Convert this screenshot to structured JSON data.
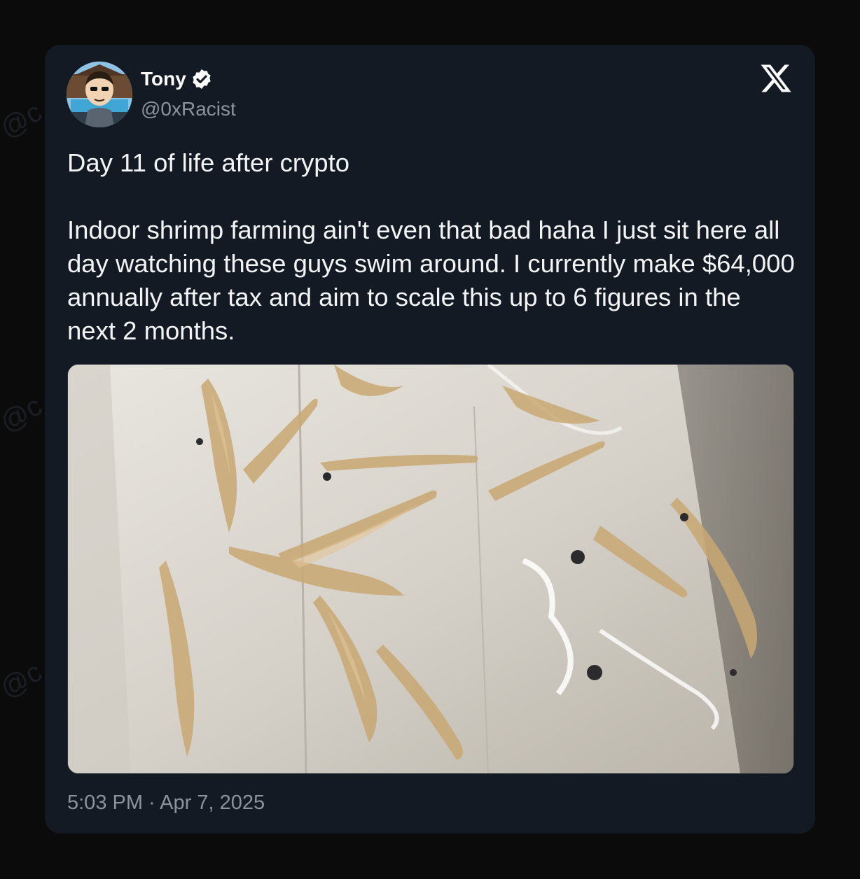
{
  "tweet": {
    "author_name": "Tony",
    "author_handle": "@0xRacist",
    "verified": true,
    "text": "Day 11 of life after crypto\n\nIndoor shrimp farming ain't even that bad haha I just sit here all day watching these guys swim around. I currently make $64,000 annually after tax and aim to scale this up to 6 figures in the next 2 months.",
    "timestamp": "5:03 PM · Apr 7, 2025"
  },
  "icons": {
    "platform_logo": "x-logo-icon",
    "verified_badge": "verified-check-icon"
  },
  "colors": {
    "card_background": "#141a23",
    "page_background": "#0b0b0c",
    "text_primary": "#f3f4f6",
    "text_secondary": "#8c939c",
    "verified_badge": "#ffffff"
  }
}
